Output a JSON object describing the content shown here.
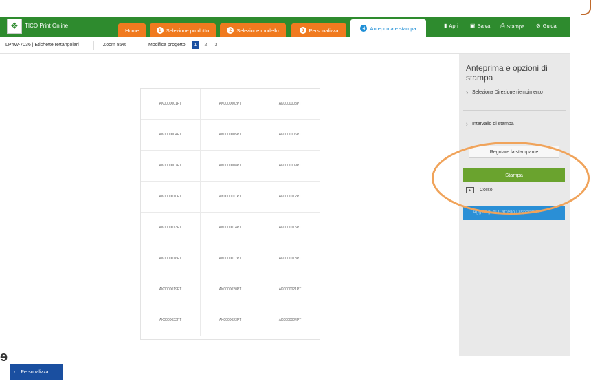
{
  "app": {
    "title": "TICO Print Online",
    "logo_icon": "tico-logo-icon"
  },
  "steps": [
    {
      "num": "",
      "label": "Home"
    },
    {
      "num": "1",
      "label": "Selezione prodotto"
    },
    {
      "num": "2",
      "label": "Selezione modello"
    },
    {
      "num": "3",
      "label": "Personalizza"
    },
    {
      "num": "4",
      "label": "Anteprima e stampa"
    }
  ],
  "top_actions": [
    {
      "icon": "folder-icon",
      "glyph": "▮",
      "label": "Apri"
    },
    {
      "icon": "save-icon",
      "glyph": "▣",
      "label": "Salva"
    },
    {
      "icon": "printer-icon",
      "glyph": "⎙",
      "label": "Stampa"
    },
    {
      "icon": "help-icon",
      "glyph": "⊘",
      "label": "Guida"
    }
  ],
  "subbar": {
    "product": "LP4W-7036 | Etichette rettangolari",
    "zoom": "Zoom 85%",
    "modify": "Modifica progetto",
    "pages": [
      "1",
      "2",
      "3"
    ]
  },
  "labels": [
    "AK0000001PT",
    "AK0000002PT",
    "AK0000003PT",
    "AK0000004PT",
    "AK0000005PT",
    "AK0000006PT",
    "AK0000007PT",
    "AK0000008PT",
    "AK0000009PT",
    "AK0000010PT",
    "AK0000011PT",
    "AK0000012PT",
    "AK0000013PT",
    "AK0000014PT",
    "AK0000015PT",
    "AK0000016PT",
    "AK0000017PT",
    "AK0000018PT",
    "AK0000019PT",
    "AK0000020PT",
    "AK0000021PT",
    "AK0000022PT",
    "AK0000023PT",
    "AK0000024PT"
  ],
  "panel": {
    "title": "Anteprima e opzioni di stampa",
    "items": [
      "Seleziona Direzione riempimento",
      "Intervallo di stampa"
    ],
    "adjust_button": "Regolare la stampante",
    "print_button": "Stampa",
    "course_label": "Corso",
    "blue_button": "Aggiungi al Carrello Dispositivo"
  },
  "footer": {
    "back_button": "Personalizza"
  },
  "colors": {
    "green": "#2e8b2e",
    "orange": "#f07a1f",
    "blue": "#1a4fa0",
    "print_green": "#6aa32e",
    "highlight": "#f0a35a"
  }
}
